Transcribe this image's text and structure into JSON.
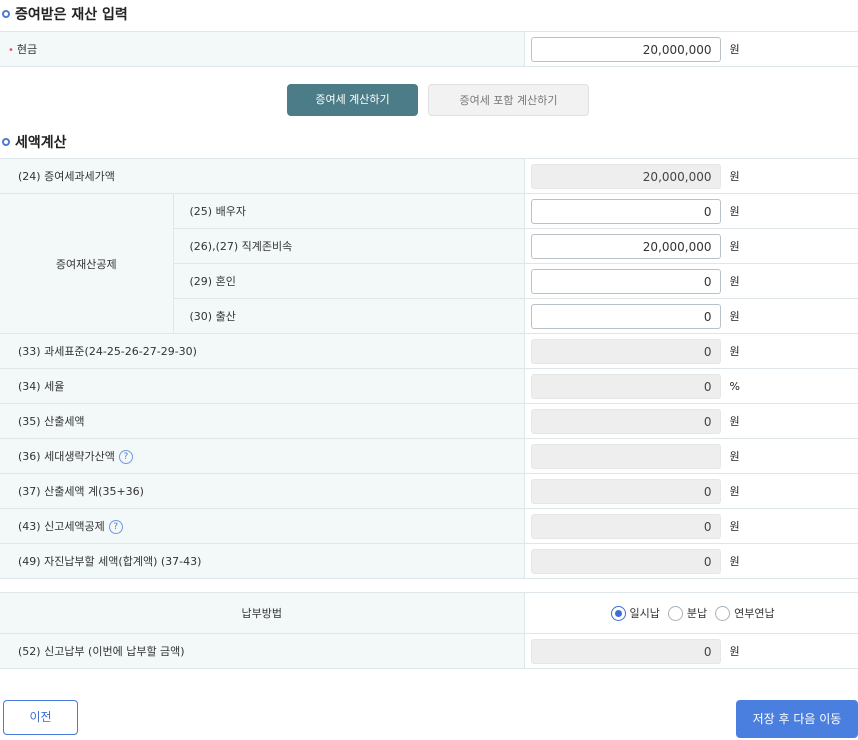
{
  "section1": {
    "title": "증여받은 재산 입력",
    "required_mark": "•",
    "cash_label": "현금",
    "cash_value": "20,000,000",
    "unit_won": "원"
  },
  "buttons": {
    "calc": "증여세 계산하기",
    "calc_incl": "증여세 포함 계산하기",
    "prev": "이전",
    "next": "저장 후 다음 이동"
  },
  "section2": {
    "title": "세액계산",
    "help_glyph": "?",
    "rows": {
      "r24": {
        "label": "(24) 증여세과세가액",
        "value": "20,000,000",
        "unit": "원"
      },
      "deduction_group": "증여재산공제",
      "r25": {
        "label": "(25) 배우자",
        "value": "0",
        "unit": "원"
      },
      "r2627": {
        "label": "(26),(27) 직계존비속",
        "value": "20,000,000",
        "unit": "원"
      },
      "r29": {
        "label": "(29) 혼인",
        "value": "0",
        "unit": "원"
      },
      "r30": {
        "label": "(30) 출산",
        "value": "0",
        "unit": "원"
      },
      "r33": {
        "label": "(33) 과세표준(24-25-26-27-29-30)",
        "value": "0",
        "unit": "원"
      },
      "r34": {
        "label": "(34) 세율",
        "value": "0",
        "unit": "%"
      },
      "r35": {
        "label": "(35) 산출세액",
        "value": "0",
        "unit": "원"
      },
      "r36": {
        "label": "(36) 세대생략가산액",
        "value": "",
        "unit": "원"
      },
      "r37": {
        "label": "(37) 산출세액 계(35+36)",
        "value": "0",
        "unit": "원"
      },
      "r43": {
        "label": "(43) 신고세액공제",
        "value": "0",
        "unit": "원"
      },
      "r49": {
        "label": "(49) 자진납부할 세액(합계액) (37-43)",
        "value": "0",
        "unit": "원"
      }
    }
  },
  "payment": {
    "label": "납부방법",
    "options": [
      "일시납",
      "분납",
      "연부연납"
    ],
    "selected": "일시납",
    "r52": {
      "label": "(52) 신고납부 (이번에 납부할 금액)",
      "value": "0",
      "unit": "원"
    }
  },
  "colors": {
    "accent": "#4a7bd8",
    "primary_button": "#4b7c87",
    "next_button": "#4a7fe0",
    "label_bg": "#f3f8f8",
    "readonly_bg": "#eeeeee",
    "required": "#e05b6b"
  }
}
